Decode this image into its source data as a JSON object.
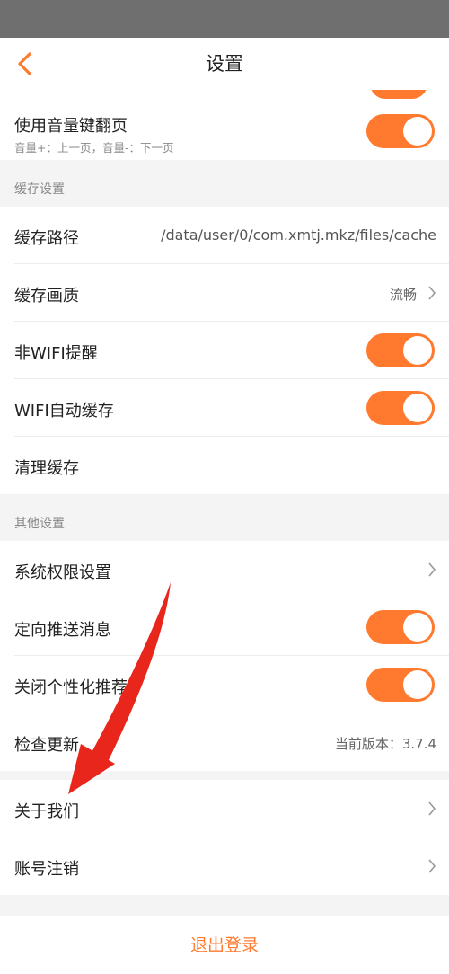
{
  "header": {
    "title": "设置",
    "back_icon": "chevron-left-icon"
  },
  "page_turn": {
    "label": "使用音量键翻页",
    "sub": "音量+：上一页，音量-：下一页",
    "enabled": true
  },
  "cache_section": {
    "title": "缓存设置",
    "path_label": "缓存路径",
    "path_value": "/data/user/0/com.xmtj.mkz/files/cache",
    "quality_label": "缓存画质",
    "quality_value": "流畅",
    "wifi_alert_label": "非WIFI提醒",
    "wifi_alert_enabled": true,
    "wifi_auto_label": "WIFI自动缓存",
    "wifi_auto_enabled": true,
    "clear_label": "清理缓存"
  },
  "other_section": {
    "title": "其他设置",
    "permissions_label": "系统权限设置",
    "push_label": "定向推送消息",
    "push_enabled": true,
    "personal_label": "关闭个性化推荐",
    "personal_enabled": true,
    "update_label": "检查更新",
    "update_value": "当前版本：3.7.4"
  },
  "about_label": "关于我们",
  "cancel_label": "账号注销",
  "logout_label": "退出登录",
  "colors": {
    "accent": "#ff7a2f",
    "annotation_arrow": "#e8261b"
  }
}
